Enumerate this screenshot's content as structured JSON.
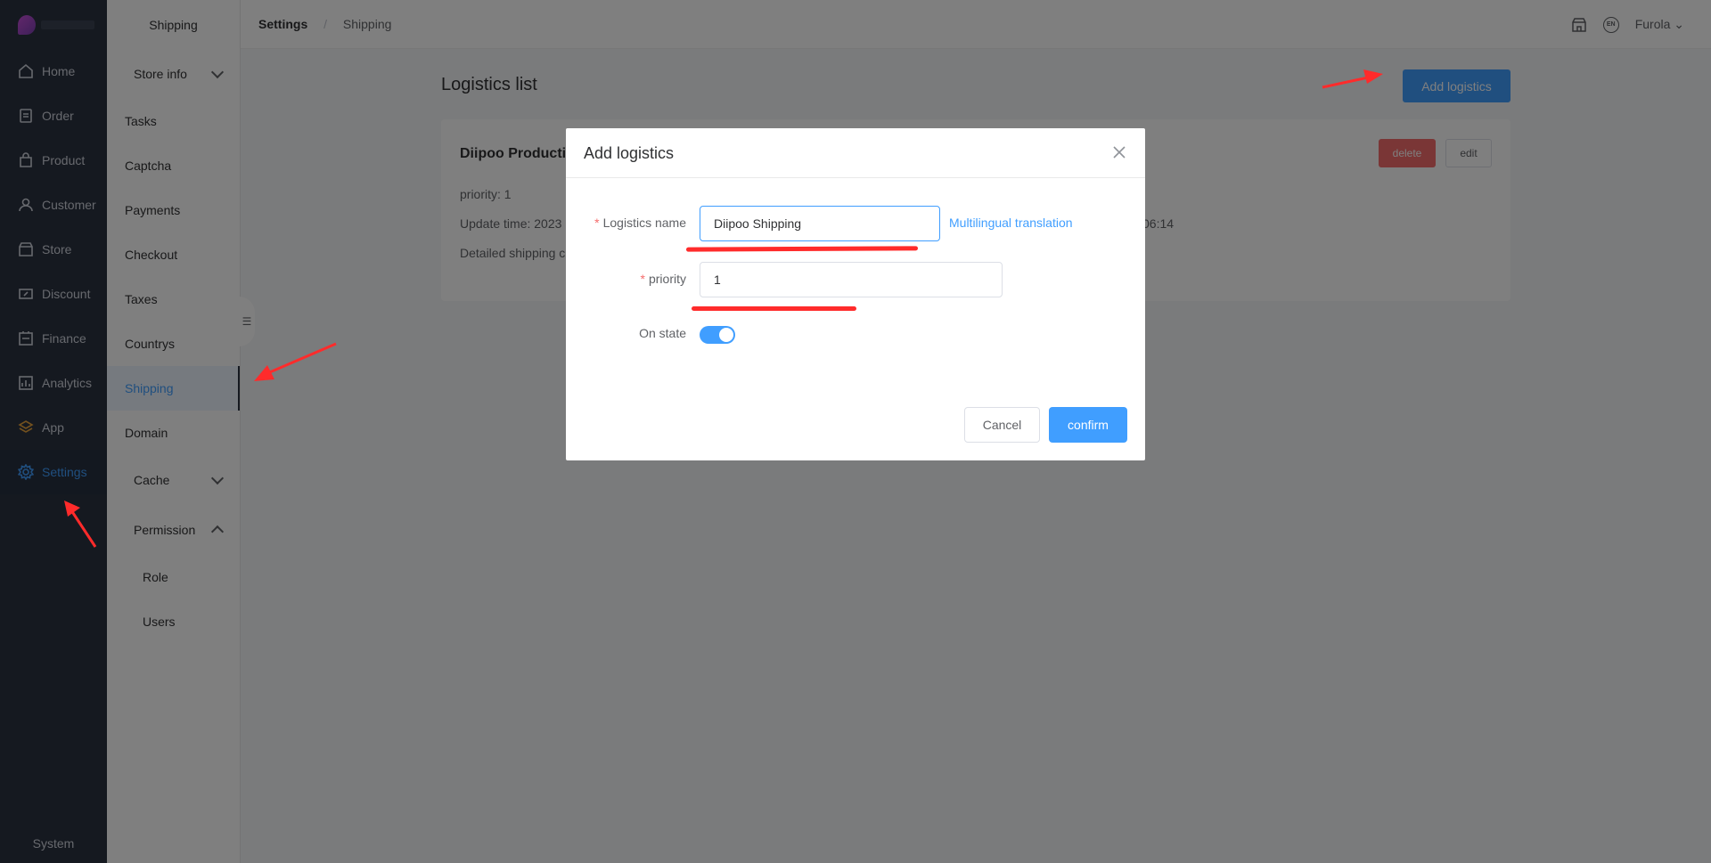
{
  "sidebar": {
    "items": [
      {
        "label": "Home",
        "icon": "home-icon"
      },
      {
        "label": "Order",
        "icon": "order-icon"
      },
      {
        "label": "Product",
        "icon": "product-icon"
      },
      {
        "label": "Customer",
        "icon": "customer-icon"
      },
      {
        "label": "Store",
        "icon": "store-icon"
      },
      {
        "label": "Discount",
        "icon": "discount-icon"
      },
      {
        "label": "Finance",
        "icon": "finance-icon"
      },
      {
        "label": "Analytics",
        "icon": "analytics-icon"
      },
      {
        "label": "App",
        "icon": "app-icon"
      },
      {
        "label": "Settings",
        "icon": "settings-icon",
        "active": true
      }
    ],
    "system": "System"
  },
  "subnav": {
    "header": "Shipping",
    "store_info": "Store info",
    "items": [
      "Tasks",
      "Captcha",
      "Payments",
      "Checkout",
      "Taxes",
      "Countrys",
      "Shipping",
      "Domain"
    ],
    "active": "Shipping",
    "cache": "Cache",
    "permission": "Permission",
    "permission_items": [
      "Role",
      "Users"
    ]
  },
  "topbar": {
    "crumb_root": "Settings",
    "crumb_sep": "/",
    "crumb_current": "Shipping",
    "user": "Furola",
    "lang": "EN"
  },
  "main": {
    "title": "Logistics list",
    "add_button": "Add logistics",
    "card": {
      "name": "Diipoo Producti",
      "priority": "priority:  1",
      "update_time": "Update time:  2023",
      "update_time_tail": "06:14",
      "detail": "Detailed shipping c",
      "delete": "delete",
      "edit": "edit"
    }
  },
  "dialog": {
    "title": "Add logistics",
    "logistics_name_label": "Logistics name",
    "logistics_name_value": "Diipoo Shipping",
    "translation_link": "Multilingual translation",
    "priority_label": "priority",
    "priority_value": "1",
    "on_state_label": "On state",
    "on_state": true,
    "cancel": "Cancel",
    "confirm": "confirm",
    "required_mark": "*"
  },
  "colors": {
    "primary": "#409eff",
    "danger": "#f56c6c",
    "sidebar_bg": "#2b3240",
    "annotation": "#ff2b2b"
  }
}
